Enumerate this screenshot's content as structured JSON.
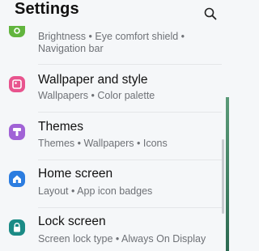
{
  "header": {
    "title": "Settings",
    "search_icon": "search-icon"
  },
  "items": [
    {
      "key": "display",
      "icon": "display-icon",
      "icon_color": "#62b53e",
      "title": "",
      "summary": "Brightness  •  Eye comfort shield  •",
      "summary2": "Navigation bar"
    },
    {
      "key": "wallpaper",
      "icon": "wallpaper-icon",
      "icon_color": "#e8548e",
      "title": "Wallpaper and style",
      "summary": "Wallpapers  •  Color palette"
    },
    {
      "key": "themes",
      "icon": "themes-icon",
      "icon_color": "#a163d6",
      "title": "Themes",
      "summary": "Themes  •  Wallpapers  •  Icons"
    },
    {
      "key": "home",
      "icon": "home-icon",
      "icon_color": "#2c7de0",
      "title": "Home screen",
      "summary": "Layout  •  App icon badges"
    },
    {
      "key": "lock",
      "icon": "lock-icon",
      "icon_color": "#1b8b86",
      "title": "Lock screen",
      "summary": "Screen lock type  •  Always On Display"
    }
  ]
}
